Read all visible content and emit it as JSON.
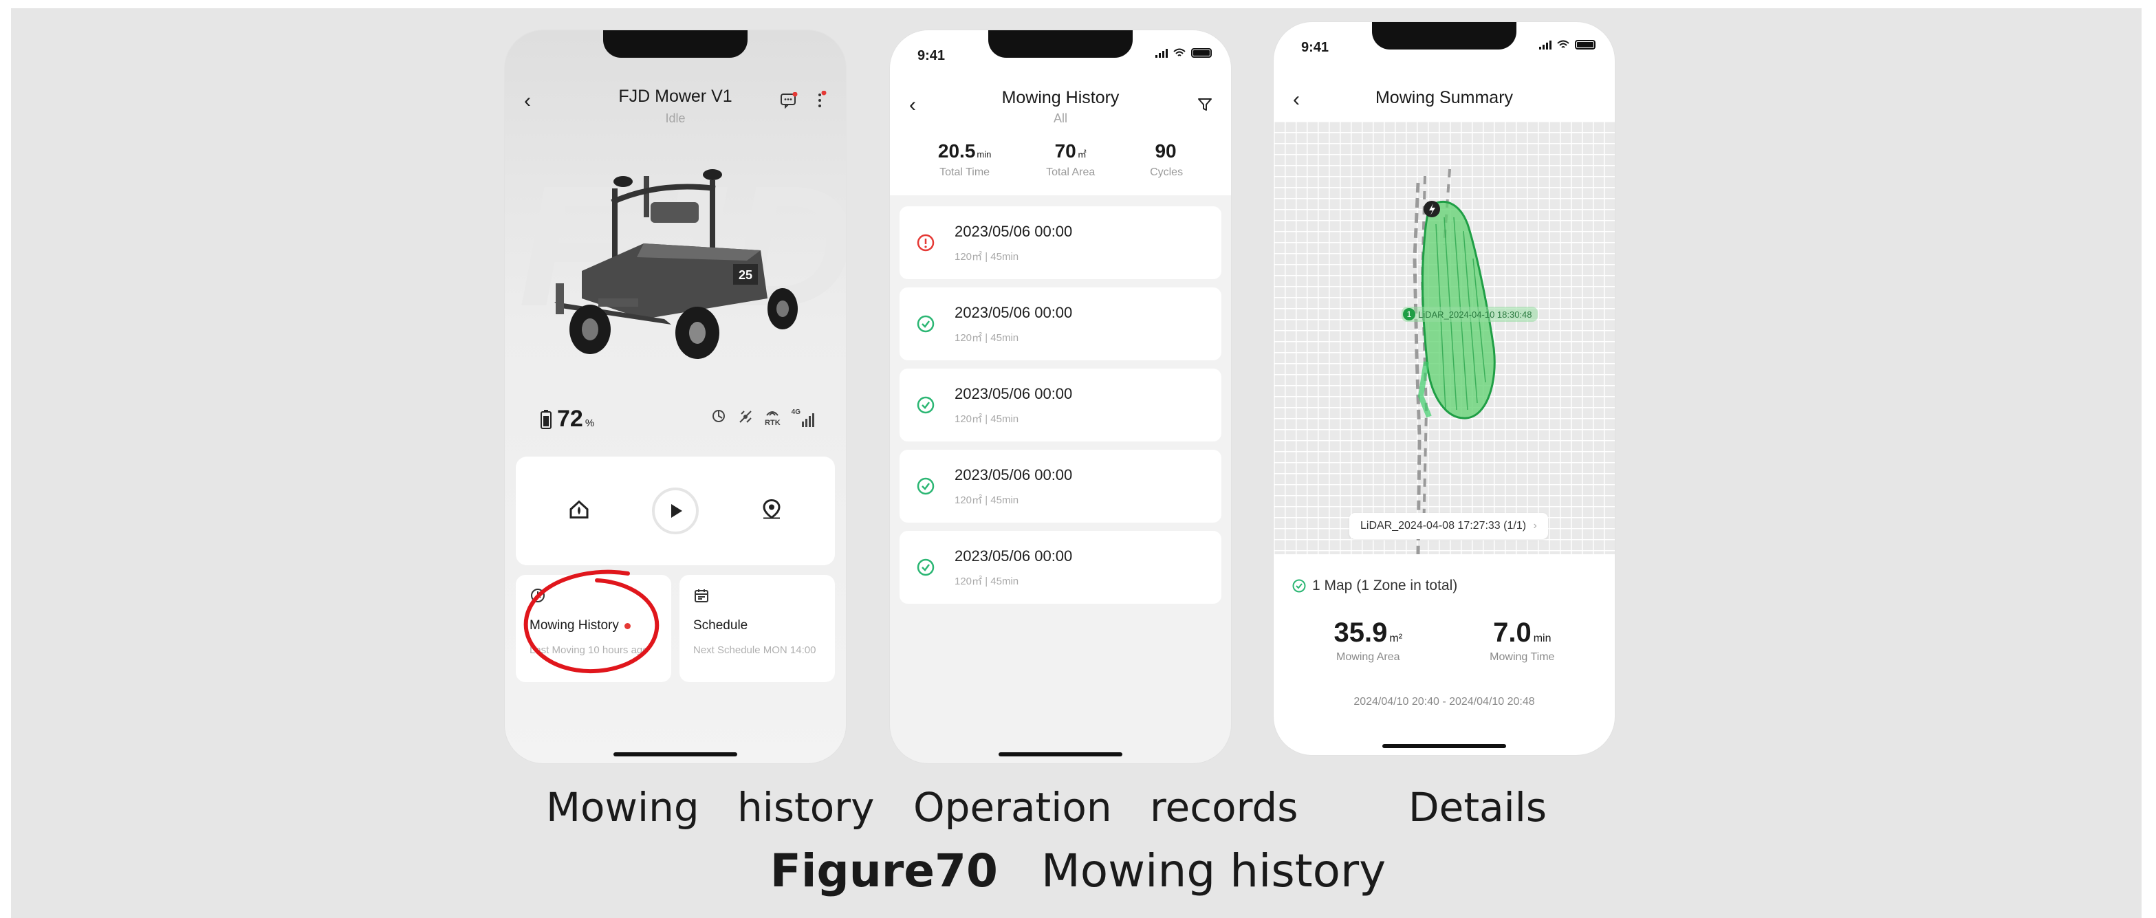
{
  "screen1": {
    "title": "FJD Mower V1",
    "status": "Idle",
    "watermark": "FJD",
    "battery": "72",
    "battery_unit": "%",
    "device_icons": [
      "sync-icon",
      "satellite-icon",
      "rtk-icon",
      "4g-signal-icon"
    ],
    "rtk_label": "RTK",
    "signal_label": "4G",
    "controls": [
      "home-icon",
      "play-icon",
      "location-pin-icon"
    ],
    "history_card": {
      "title": "Mowing History",
      "subtitle": "Last Moving 10 hours ago"
    },
    "schedule_card": {
      "title": "Schedule",
      "subtitle": "Next Schedule MON 14:00"
    },
    "annotation_color": "#e0161c"
  },
  "screen2": {
    "time": "9:41",
    "title": "Mowing History",
    "subtitle": "All",
    "stats": [
      {
        "value": "20.5",
        "unit": "min",
        "label": "Total Time"
      },
      {
        "value": "70",
        "unit": "㎡",
        "label": "Total Area"
      },
      {
        "value": "90",
        "unit": "",
        "label": "Cycles"
      }
    ],
    "records": [
      {
        "datetime": "2023/05/06 00:00",
        "meta": "120㎡  |  45min",
        "status": "error",
        "color": "#e53935"
      },
      {
        "datetime": "2023/05/06 00:00",
        "meta": "120㎡  |  45min",
        "status": "ok",
        "color": "#2bb673"
      },
      {
        "datetime": "2023/05/06 00:00",
        "meta": "120㎡  |  45min",
        "status": "ok",
        "color": "#2bb673"
      },
      {
        "datetime": "2023/05/06 00:00",
        "meta": "120㎡  |  45min",
        "status": "ok",
        "color": "#2bb673"
      },
      {
        "datetime": "2023/05/06 00:00",
        "meta": "120㎡  |  45min",
        "status": "ok",
        "color": "#2bb673"
      }
    ]
  },
  "screen3": {
    "time": "9:41",
    "title": "Mowing Summary",
    "map_label": "LiDAR_2024-04-10 18:30:48",
    "map_chip": "LiDAR_2024-04-08 17:27:33 (1/1)",
    "zone_info": "1 Map (1 Zone in total)",
    "area": {
      "value": "35.9",
      "unit": "m²",
      "label": "Mowing Area"
    },
    "time_stat": {
      "value": "7.0",
      "unit": "min",
      "label": "Mowing Time"
    },
    "date_range": "2024/04/10 20:40 - 2024/04/10 20:48",
    "zone_color": "#3ecf6b"
  },
  "captions": {
    "c1": "Mowing   history",
    "c2": "Operation   records",
    "c3": "Details"
  },
  "figure": {
    "label": "Figure70",
    "title": "Mowing history"
  }
}
